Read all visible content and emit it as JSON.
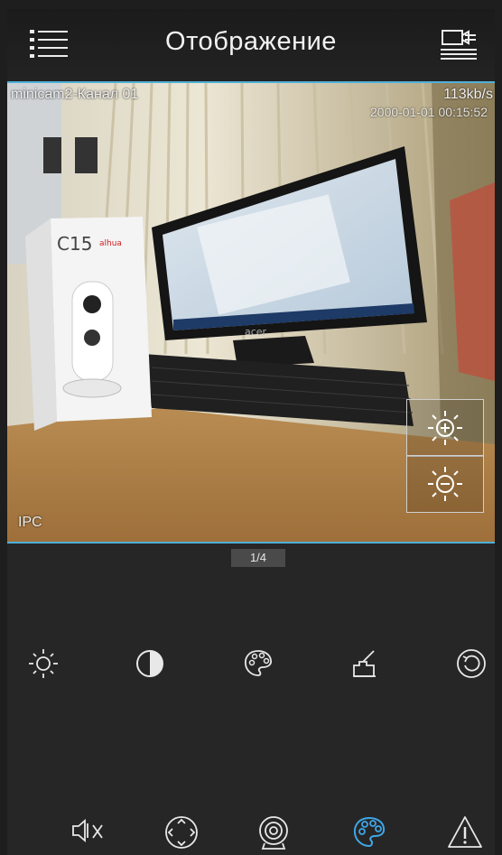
{
  "header": {
    "title": "Отображение",
    "menu_icon": "hamburger-menu-icon",
    "layout_icon": "channel-list-icon"
  },
  "video": {
    "channel_name": "minicam2-Канал 01",
    "bitrate": "113kb/s",
    "timestamp": "2000-01-01 00:15:52",
    "device_type": "IPC",
    "zoom_in_icon": "brightness-plus-icon",
    "zoom_out_icon": "brightness-minus-icon",
    "box_label": "C15",
    "box_brand": "alhua",
    "monitor_brand": "acer"
  },
  "pager": {
    "label": "1/4"
  },
  "tools": [
    {
      "name": "brightness-icon"
    },
    {
      "name": "contrast-icon"
    },
    {
      "name": "color-palette-icon"
    },
    {
      "name": "sharpness-icon"
    },
    {
      "name": "reset-icon"
    }
  ],
  "bottom": [
    {
      "name": "mute-icon",
      "active": false
    },
    {
      "name": "ptz-icon",
      "active": false
    },
    {
      "name": "fisheye-icon",
      "active": false
    },
    {
      "name": "image-adjust-icon",
      "active": true
    },
    {
      "name": "alarm-icon",
      "active": false
    }
  ],
  "colors": {
    "accent": "#3fa6e6",
    "border": "#4fb0d8",
    "icon": "#e8e8e8"
  }
}
